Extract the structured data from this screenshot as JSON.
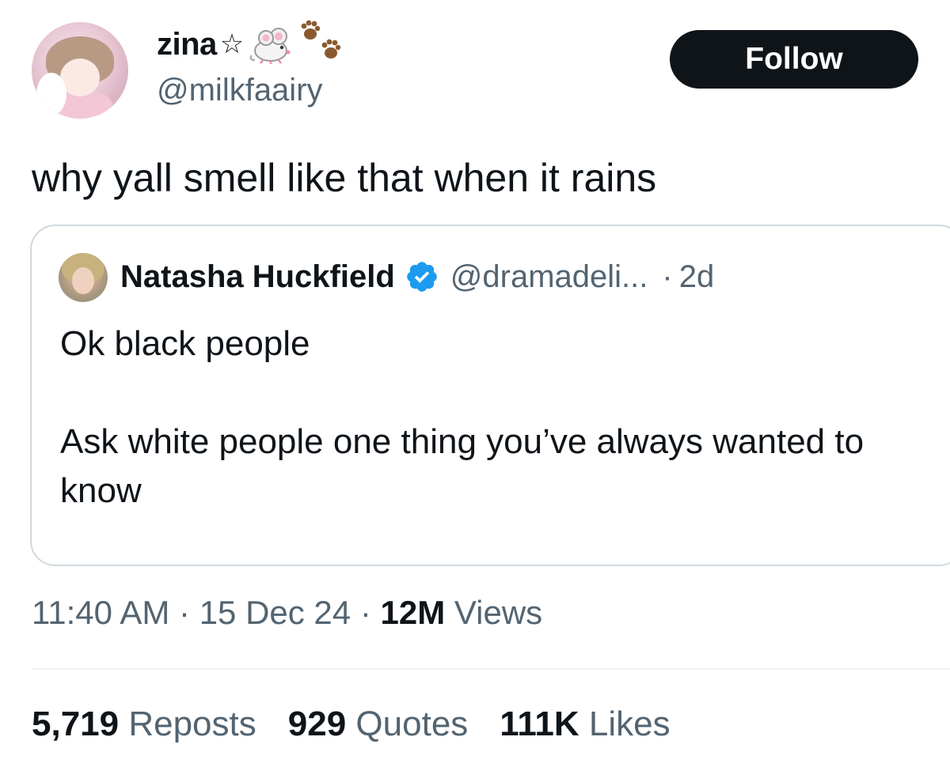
{
  "author": {
    "display_name": "zina",
    "name_icons": [
      "star-outline-icon",
      "mouse-icon",
      "paw-prints-icon"
    ],
    "star_glyph": "☆",
    "handle": "@milkfaairy"
  },
  "follow_button": {
    "label": "Follow"
  },
  "tweet": {
    "text": "why yall smell like that when it rains"
  },
  "quote": {
    "name": "Natasha Huckfield",
    "verified": true,
    "handle": "@dramadeli...",
    "separator": "·",
    "time": "2d",
    "lines": [
      "Ok black people",
      "Ask white people one thing you’ve always wanted to know"
    ]
  },
  "meta": {
    "time": "11:40 AM",
    "separator": "·",
    "date": "15 Dec 24",
    "views_count": "12M",
    "views_label": "Views"
  },
  "stats": {
    "reposts_count": "5,719",
    "reposts_label": "Reposts",
    "quotes_count": "929",
    "quotes_label": "Quotes",
    "likes_count": "111K",
    "likes_label": "Likes"
  },
  "colors": {
    "text": "#0f1419",
    "secondary": "#536471",
    "verified": "#1d9bf0",
    "follow_bg": "#0f1419",
    "border": "#cfd9de"
  }
}
